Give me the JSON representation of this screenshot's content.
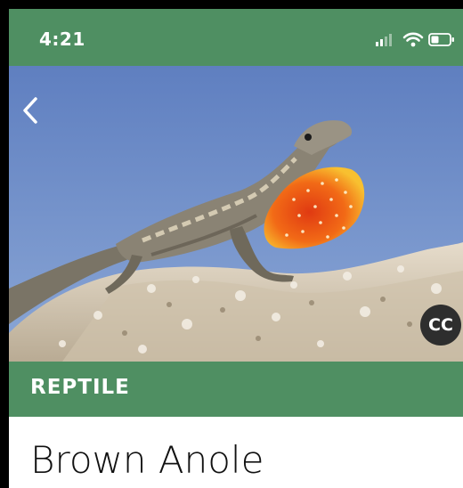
{
  "status_bar": {
    "time": "4:21",
    "icons": [
      "signal-icon",
      "wifi-icon",
      "battery-icon"
    ]
  },
  "hero": {
    "image": "brown-anole-photo",
    "back_icon": "chevron-left-icon",
    "cc_badge": "CC"
  },
  "category": {
    "label": "REPTILE"
  },
  "species": {
    "name": "Brown Anole"
  },
  "colors": {
    "brand": "#4f8f62",
    "sky": "#6f8fc8",
    "dewlap": "#f07a18"
  }
}
